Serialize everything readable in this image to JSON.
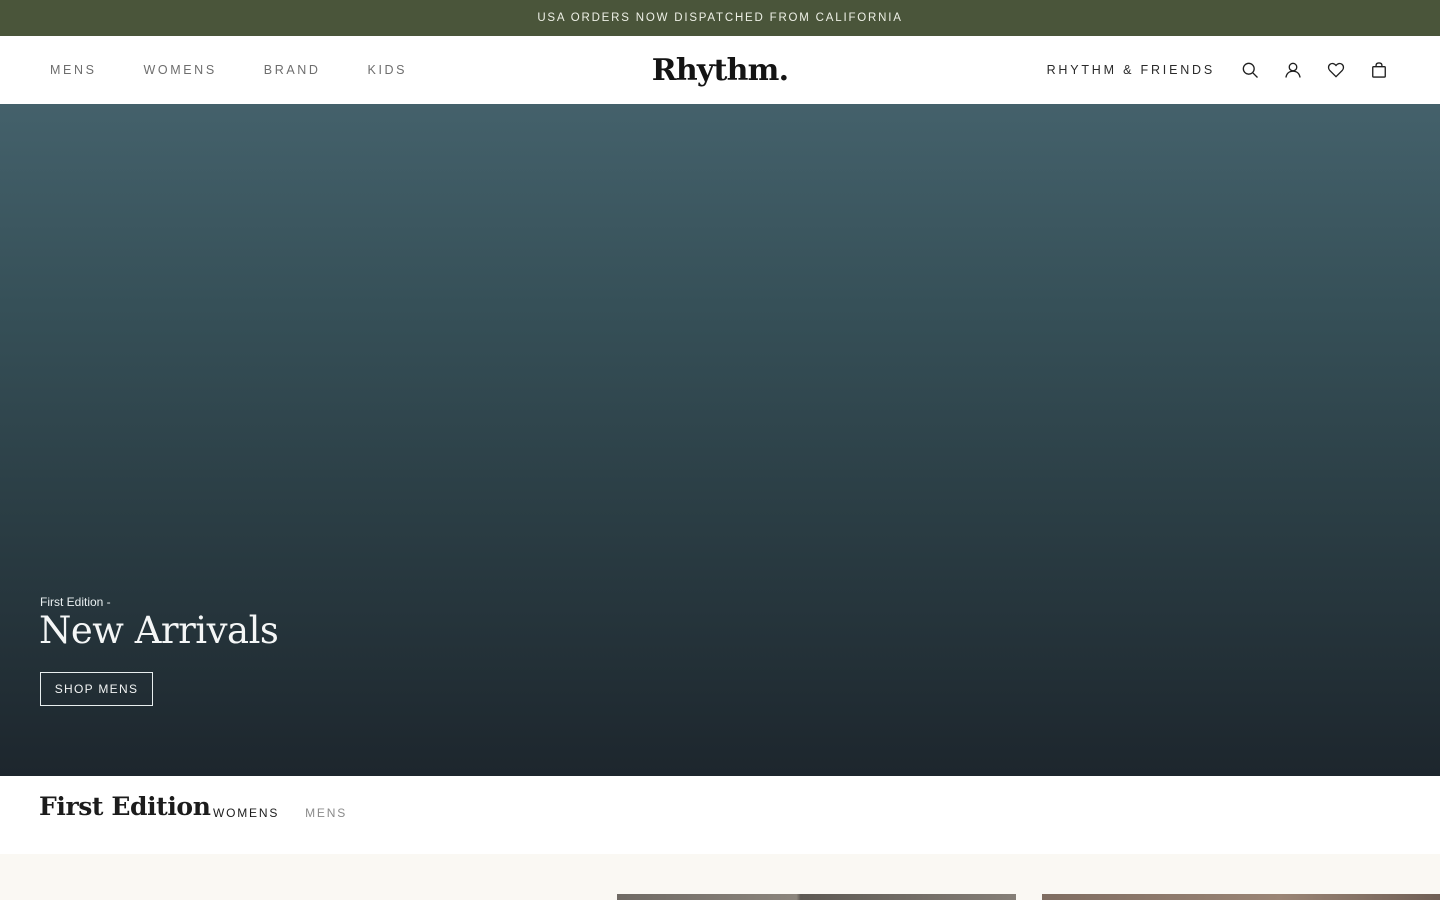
{
  "announcement": {
    "text": "USA ORDERS NOW DISPATCHED FROM CALIFORNIA"
  },
  "header": {
    "nav_left": [
      {
        "label": "MENS"
      },
      {
        "label": "WOMENS"
      },
      {
        "label": "BRAND"
      },
      {
        "label": "KIDS"
      }
    ],
    "logo": "Rhythm.",
    "friends_link": "RHYTHM & FRIENDS",
    "icons": [
      "search-icon",
      "account-icon",
      "wishlist-heart-icon",
      "shopping-bag-icon"
    ]
  },
  "hero": {
    "eyebrow": "First Edition -",
    "title": "New Arrivals",
    "button_label": "SHOP MENS"
  },
  "section": {
    "title": "First Edition",
    "tabs": [
      {
        "label": "WOMENS",
        "active": true
      },
      {
        "label": "MENS",
        "active": false
      }
    ]
  },
  "colors": {
    "announcement_bg": "#4a553a",
    "hero_top": "#44616b",
    "hero_bottom": "#1d262d",
    "product_strip_bg": "#faf8f3"
  }
}
